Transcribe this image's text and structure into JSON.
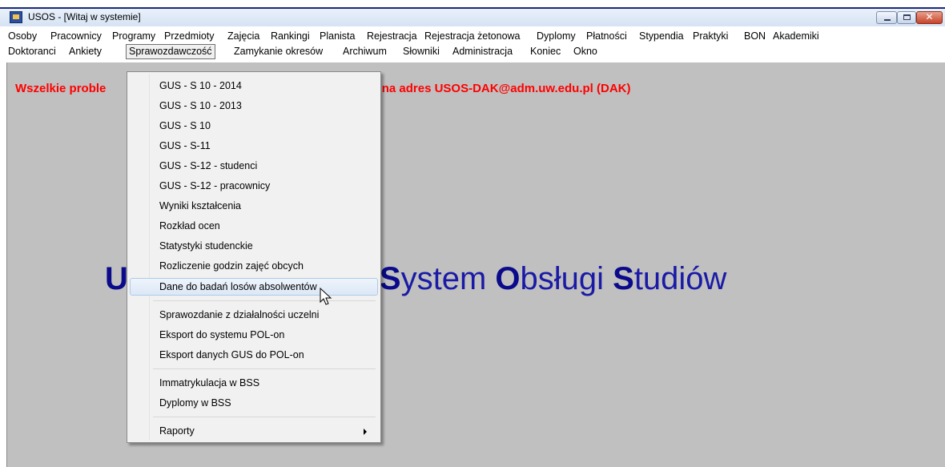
{
  "window": {
    "title": "USOS - [Witaj w systemie]",
    "close_symbol": "✕"
  },
  "menubar": {
    "row1": [
      "Osoby",
      "Pracownicy",
      "Programy",
      "Przedmioty",
      "Zajęcia",
      "Rankingi",
      "Planista",
      "Rejestracja",
      "Rejestracja żetonowa",
      "Dyplomy",
      "Płatności",
      "Stypendia",
      "Praktyki",
      "BON",
      "Akademiki"
    ],
    "row2": [
      "Doktoranci",
      "Ankiety",
      "Sprawozdawczość",
      "Zamykanie okresów",
      "Archiwum",
      "Słowniki",
      "Administracja",
      "Koniec",
      "Okno"
    ],
    "open_menu": "Sprawozdawczość"
  },
  "content": {
    "warning_left": "Wszelkie proble",
    "warning_right": "zać na adres USOS-DAK@adm.uw.edu.pl (DAK)",
    "big_title_initial": "U",
    "big_title_parts": [
      "S",
      "ystem ",
      "O",
      "bsługi ",
      "S",
      "tudiów"
    ]
  },
  "dropdown": {
    "items": [
      "GUS - S 10 - 2014",
      "GUS - S 10 - 2013",
      "GUS - S 10",
      "GUS - S-11",
      "GUS - S-12 - studenci",
      "GUS - S-12 - pracownicy",
      "Wyniki kształcenia",
      "Rozkład ocen",
      "Statystyki studenckie",
      "Rozliczenie godzin zajęć obcych",
      "Dane do badań losów absolwentów",
      "Sprawozdanie z działalności uczelni",
      "Eksport do systemu POL-on",
      "Eksport danych GUS do POL-on",
      "Immatrykulacja w BSS",
      "Dyplomy w BSS",
      "Raporty"
    ],
    "hovered": "Dane do badań losów absolwentów"
  },
  "colors": {
    "warning": "#ff0000",
    "title": "#1a1aa6",
    "desktop": "#c0c0c0"
  }
}
